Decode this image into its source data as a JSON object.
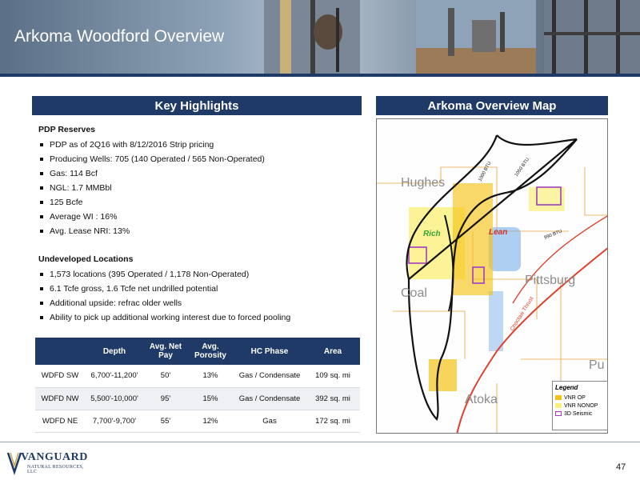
{
  "header": {
    "title": "Arkoma Woodford Overview"
  },
  "highlights": {
    "heading": "Key Highlights",
    "pdp": {
      "title": "PDP Reserves",
      "items": [
        "PDP as of 2Q16 with 8/12/2016 Strip pricing",
        "Producing Wells: 705 (140 Operated / 565 Non-Operated)",
        "Gas: 114 Bcf",
        "NGL: 1.7 MMBbl",
        "125 Bcfe",
        "Average WI : 16%",
        "Avg. Lease NRI: 13%"
      ]
    },
    "undeveloped": {
      "title": "Undeveloped Locations",
      "items": [
        "1,573 locations (395 Operated / 1,178 Non-Operated)",
        "6.1 Tcfe gross, 1.6 Tcfe net undrilled potential",
        "Additional upside: refrac older wells",
        "Ability to pick up additional working interest due to forced pooling"
      ]
    }
  },
  "table": {
    "headers": [
      "",
      "Depth",
      "Avg. Net Pay",
      "Avg. Porosity",
      "HC Phase",
      "Area"
    ],
    "rows": [
      [
        "WDFD SW",
        "6,700'-11,200'",
        "50'",
        "13%",
        "Gas / Condensate",
        "109 sq. mi"
      ],
      [
        "WDFD NW",
        "5,500'-10,000'",
        "95'",
        "15%",
        "Gas / Condensate",
        "392 sq. mi"
      ],
      [
        "WDFD NE",
        "7,700'-9,700'",
        "55'",
        "12%",
        "Gas",
        "172 sq. mi"
      ]
    ]
  },
  "map": {
    "heading": "Arkoma Overview Map",
    "county_labels": [
      "Hughes",
      "Coal",
      "Pittsburg",
      "Atoka",
      "Pu"
    ],
    "zone_labels": [
      "Rich",
      "Lean"
    ],
    "btu_labels": [
      "1000 BTU",
      "1050 BTU",
      "990 BTU"
    ],
    "thrust_label": "Choctaw Thrust",
    "colors": {
      "operated": "#f3c318",
      "nonoperated": "#faf07a",
      "seismic": "#a23cbf",
      "thrust": "#e0402a",
      "boundary": "#111111"
    },
    "legend": {
      "title": "Legend",
      "items": [
        {
          "label": "VNR OP",
          "color": "#f3c318"
        },
        {
          "label": "VNR NONOP",
          "color": "#faf07a"
        },
        {
          "label": "3D Seismic",
          "color": "#a23cbf"
        }
      ]
    }
  },
  "footer": {
    "logo_name": "VANGUARD",
    "logo_sub": "NATURAL RESOURCES, LLC",
    "page_number": "47"
  }
}
